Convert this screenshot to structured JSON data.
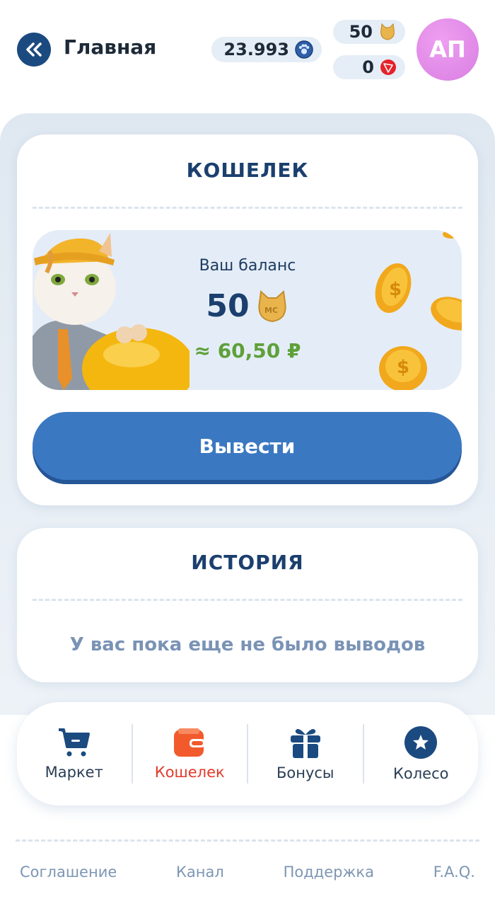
{
  "header": {
    "title": "Главная",
    "back_icon": "double-chevron-left-icon",
    "paw_balance": "23.993",
    "mc_balance": "50",
    "trx_balance": "0",
    "avatar_initials": "АП"
  },
  "wallet": {
    "title": "КОШЕЛЕК",
    "balance_label": "Ваш баланс",
    "balance_value": "50",
    "balance_rub": "≈ 60,50 ₽",
    "withdraw_label": "Вывести"
  },
  "history": {
    "title": "ИСТОРИЯ",
    "empty_text": "У вас пока еще не было выводов"
  },
  "nav": {
    "items": [
      {
        "label": "Маркет",
        "icon": "cart-icon"
      },
      {
        "label": "Кошелек",
        "icon": "wallet-icon"
      },
      {
        "label": "Бонусы",
        "icon": "gift-icon"
      },
      {
        "label": "Колесо",
        "icon": "star-circle-icon"
      }
    ]
  },
  "footer": {
    "links": [
      "Соглашение",
      "Канал",
      "Поддержка",
      "F.A.Q."
    ]
  },
  "colors": {
    "accent": "#3b78c2",
    "active_nav": "#e23a2b",
    "positive": "#5fa03a",
    "title": "#1b3f6e"
  }
}
